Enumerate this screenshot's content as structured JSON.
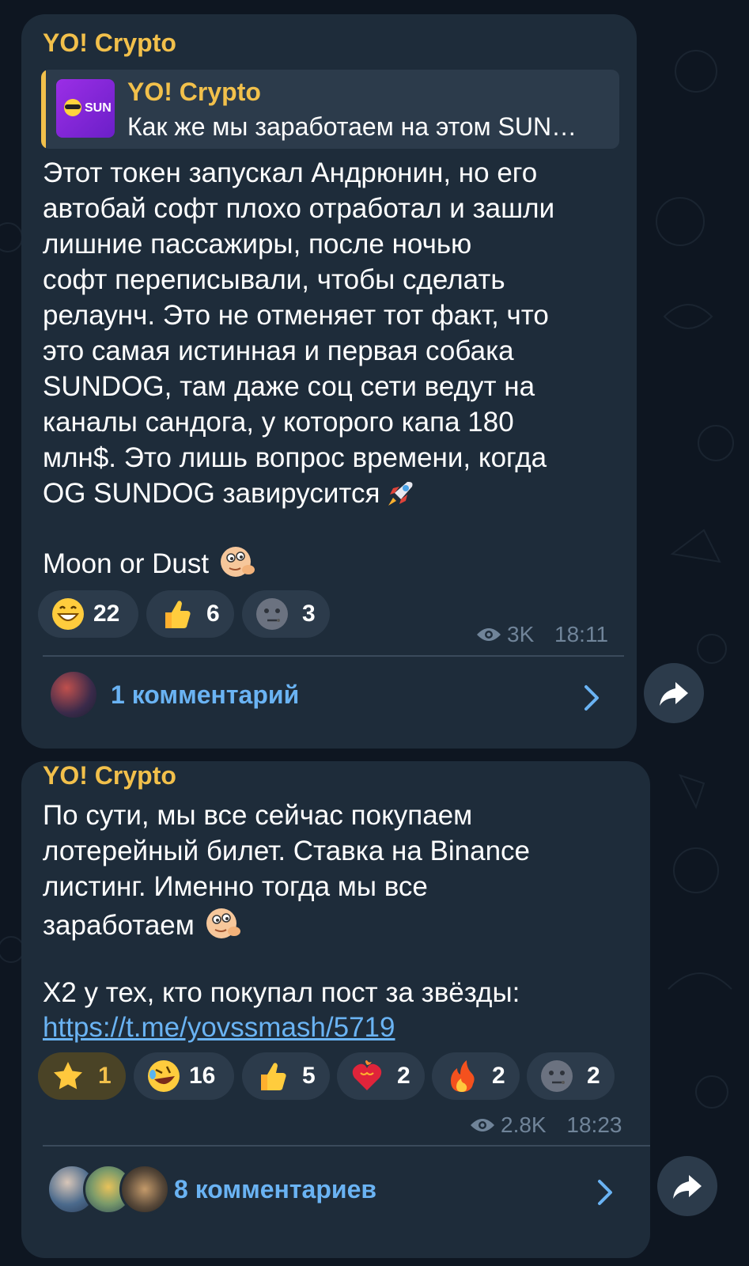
{
  "posts": [
    {
      "channel": "YO! Crypto",
      "reply": {
        "title": "YO! Crypto",
        "text": "Как же мы заработаем на этом SUN…",
        "thumb_label": "SUN"
      },
      "text": "Этот токен запускал Андрюнин, но его\nавтобай софт плохо отработал и зашли\nлишние пассажиры, после ночью\nсофт переписывали, чтобы сделать\nрелаунч. Это не отменяет тот факт, что\nэто самая истинная и первая собака\nSUNDOG, там даже соц сети ведут на\nканалы сандога, у которого капа 180\nмлн$. Это лишь вопрос времени, когда\nOG SUNDOG завирусится",
      "text2": "Moon or Dust",
      "reactions": [
        {
          "icon": "grinning-face-icon",
          "count": "22"
        },
        {
          "icon": "thumbs-up-icon",
          "count": "6"
        },
        {
          "icon": "moon-face-icon",
          "count": "3"
        }
      ],
      "views": "3K",
      "time": "18:11",
      "comments": "1 комментарий"
    },
    {
      "channel": "YO! Crypto",
      "text": "По сути, мы все сейчас покупаем\nлотерейный билет. Ставка на Binance\nлистинг. Именно тогда мы все\nзаработаем",
      "text2": "X2 у тех, кто покупал пост за звёзды:",
      "link": "https://t.me/yovssmash/5719",
      "reactions": [
        {
          "icon": "star-icon",
          "count": "1",
          "active": true
        },
        {
          "icon": "rofl-face-icon",
          "count": "16"
        },
        {
          "icon": "thumbs-up-icon",
          "count": "5"
        },
        {
          "icon": "heart-on-fire-icon",
          "count": "2"
        },
        {
          "icon": "fire-icon",
          "count": "2"
        },
        {
          "icon": "moon-face-icon",
          "count": "2"
        }
      ],
      "views": "2.8K",
      "time": "18:23",
      "comments": "8 комментариев"
    }
  ],
  "colors": {
    "background": "#0e1621",
    "bubble": "#1e2c3a",
    "accent_gold": "#f2c04b",
    "link_blue": "#6ab3f3",
    "meta_gray": "#708499"
  }
}
